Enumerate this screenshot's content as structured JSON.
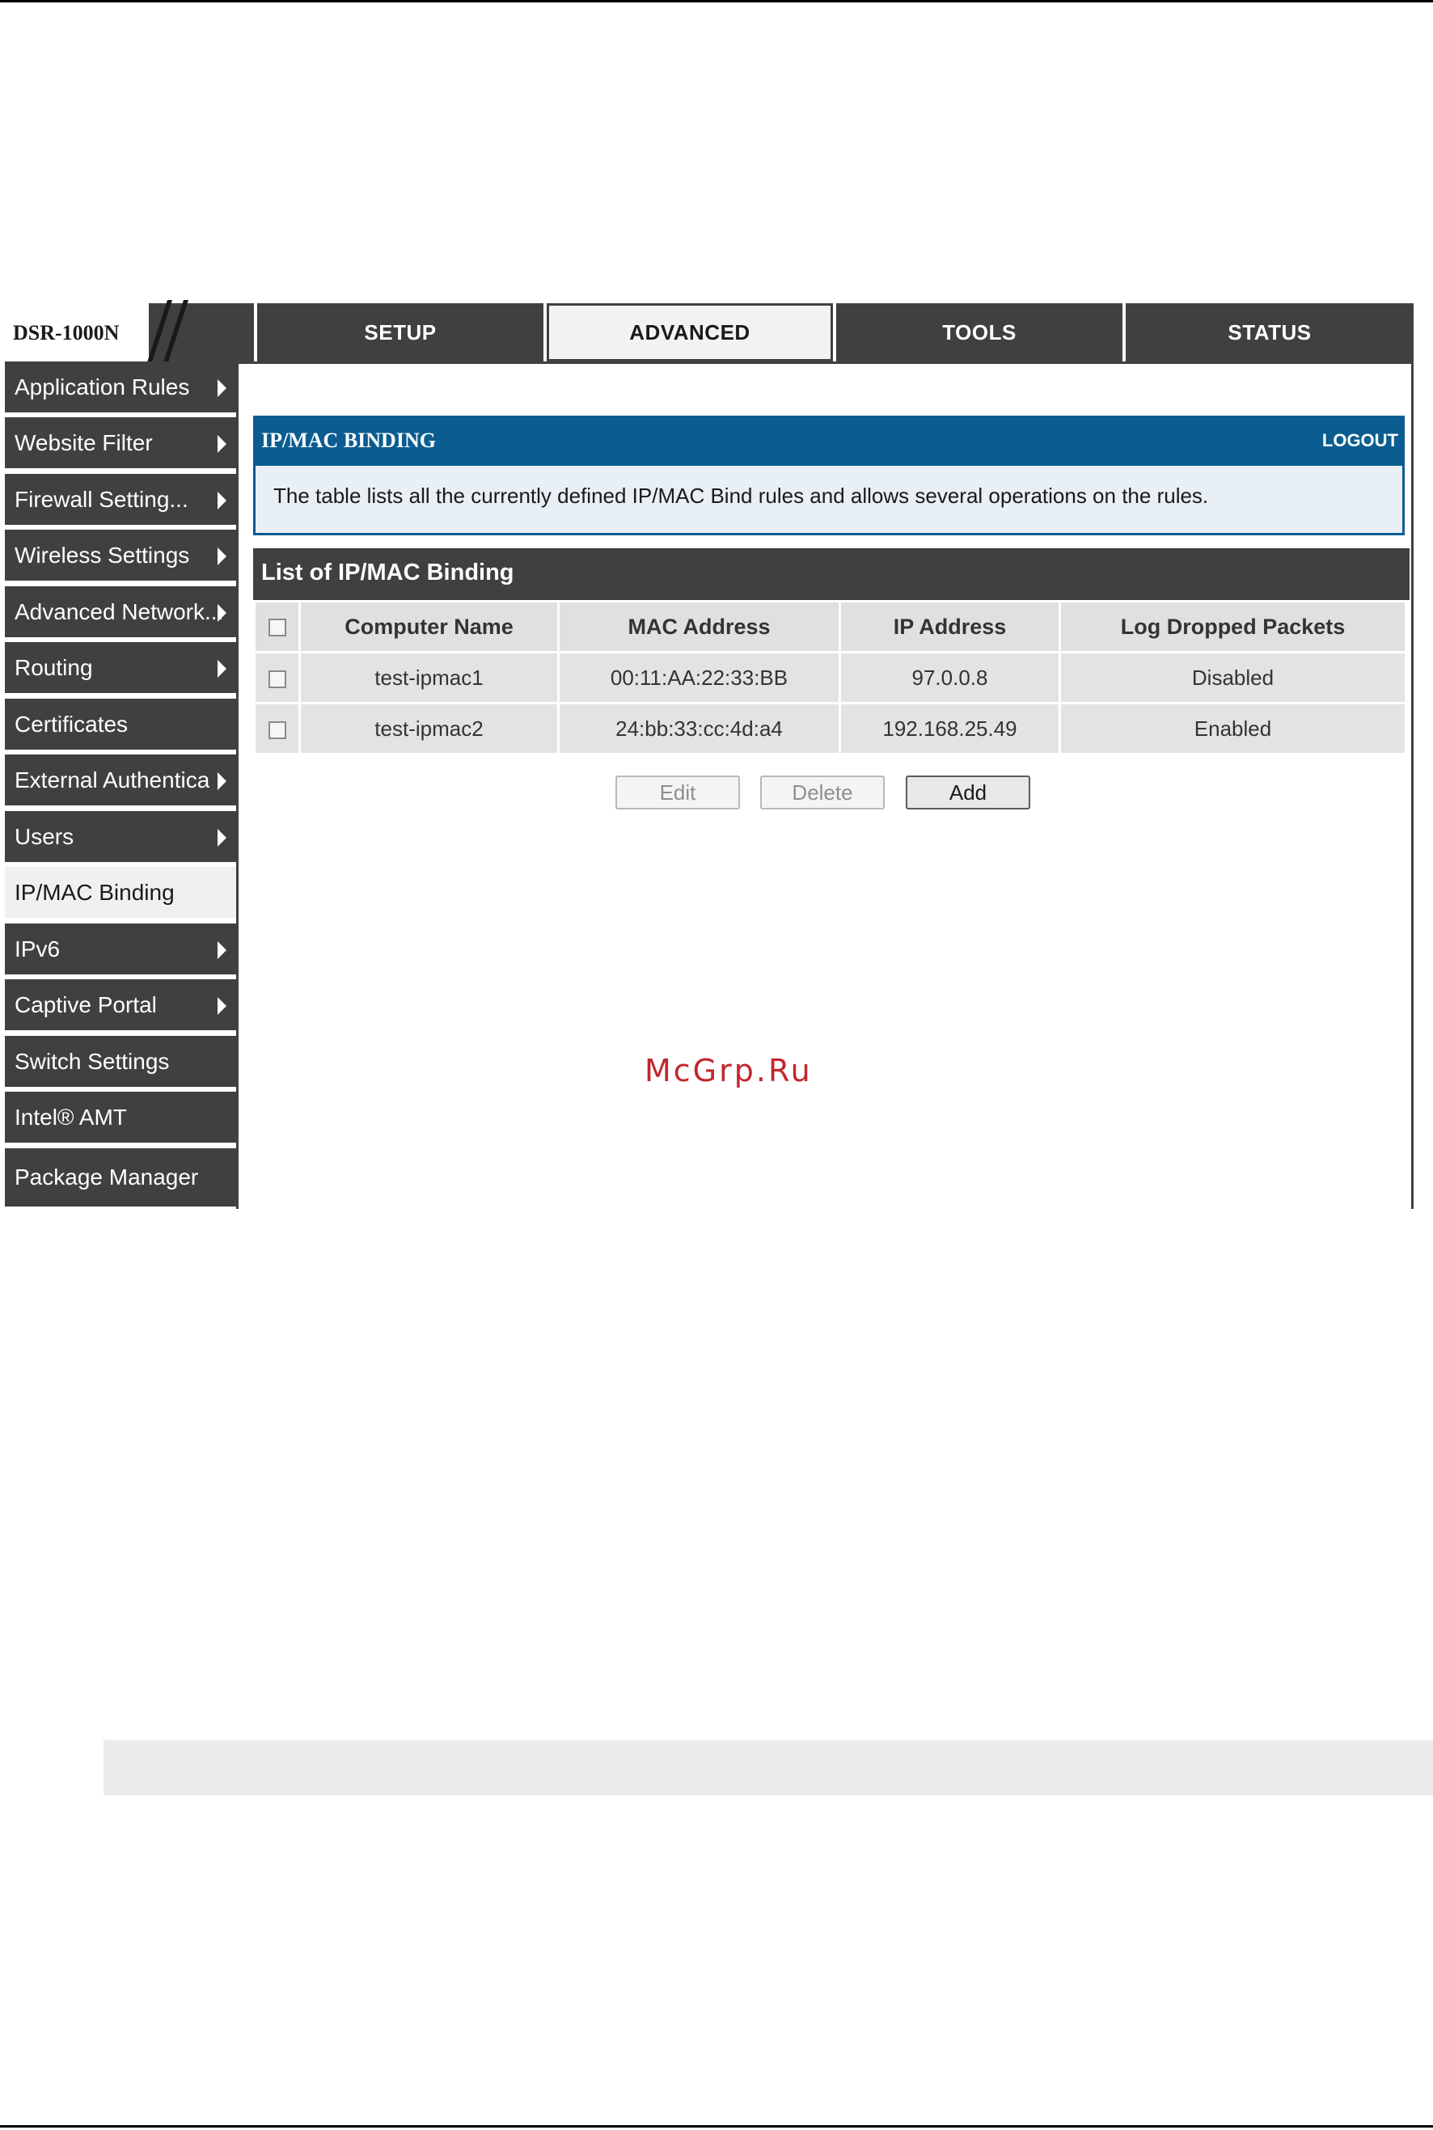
{
  "brand": {
    "model": "DSR-1000N"
  },
  "nav": {
    "tabs": [
      {
        "label": "SETUP",
        "active": false
      },
      {
        "label": "ADVANCED",
        "active": true
      },
      {
        "label": "TOOLS",
        "active": false
      },
      {
        "label": "STATUS",
        "active": false
      }
    ]
  },
  "sidebar": {
    "items": [
      {
        "label": "Application Rules",
        "submenu": true
      },
      {
        "label": "Website Filter",
        "submenu": true
      },
      {
        "label": "Firewall Setting...",
        "submenu": true
      },
      {
        "label": "Wireless Settings",
        "submenu": true
      },
      {
        "label": "Advanced Network...",
        "submenu": true
      },
      {
        "label": "Routing",
        "submenu": true
      },
      {
        "label": "Certificates",
        "submenu": false
      },
      {
        "label": "External Authentica",
        "submenu": true
      },
      {
        "label": "Users",
        "submenu": true
      },
      {
        "label": "IP/MAC Binding",
        "submenu": false,
        "active": true
      },
      {
        "label": "IPv6",
        "submenu": true
      },
      {
        "label": "Captive Portal",
        "submenu": true
      },
      {
        "label": "Switch Settings",
        "submenu": false
      },
      {
        "label": "Intel® AMT",
        "submenu": false
      },
      {
        "label": "Package Manager",
        "submenu": false
      }
    ]
  },
  "panel": {
    "title": "IP/MAC BINDING",
    "logout": "LOGOUT",
    "description": "The table lists all the currently defined IP/MAC Bind rules and allows several operations on the rules."
  },
  "list": {
    "title": "List of IP/MAC Binding",
    "columns": [
      "Computer Name",
      "MAC Address",
      "IP Address",
      "Log Dropped Packets"
    ],
    "rows": [
      [
        "test-ipmac1",
        "00:11:AA:22:33:BB",
        "97.0.0.8",
        "Disabled"
      ],
      [
        "test-ipmac2",
        "24:bb:33:cc:4d:a4",
        "192.168.25.49",
        "Enabled"
      ]
    ]
  },
  "actions": {
    "edit": "Edit",
    "delete": "Delete",
    "add": "Add"
  },
  "watermark": "McGrp.Ru",
  "colors": {
    "dark": "#404040",
    "header_blue": "#0a5c91",
    "watermark_red": "#c1272d"
  }
}
